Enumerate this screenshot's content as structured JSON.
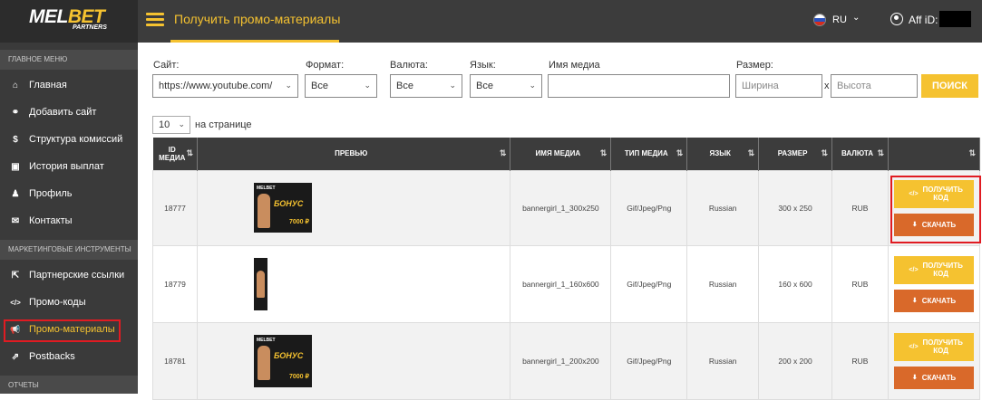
{
  "brand": {
    "logo_left": "MEL",
    "logo_right": "BET",
    "logo_sub": "PARTNERS"
  },
  "sidebar": {
    "section_main": "ГЛАВНОЕ МЕНЮ",
    "items_main": [
      {
        "label": "Главная",
        "icon": "home-icon",
        "glyph": "⌂"
      },
      {
        "label": "Добавить сайт",
        "icon": "link-icon",
        "glyph": "⚭"
      },
      {
        "label": "Структура комиссий",
        "icon": "dollar-icon",
        "glyph": "$"
      },
      {
        "label": "История выплат",
        "icon": "money-icon",
        "glyph": "▣"
      },
      {
        "label": "Профиль",
        "icon": "user-icon",
        "glyph": "♟"
      },
      {
        "label": "Контакты",
        "icon": "envelope-icon",
        "glyph": "✉"
      }
    ],
    "section_marketing": "МАРКЕТИНГОВЫЕ ИНСТРУМЕНТЫ",
    "items_marketing": [
      {
        "label": "Партнерские ссылки",
        "icon": "external-link-icon",
        "glyph": "⇱"
      },
      {
        "label": "Промо-коды",
        "icon": "code-icon",
        "glyph": "</>"
      },
      {
        "label": "Промо-материалы",
        "icon": "bullhorn-icon",
        "glyph": "📢"
      },
      {
        "label": "Postbacks",
        "icon": "share-icon",
        "glyph": "⇗"
      }
    ],
    "section_reports": "ОТЧЕТЫ"
  },
  "topbar": {
    "title": "Получить промо-материалы",
    "lang": "RU",
    "aff_label": "Aff iD:"
  },
  "filters": {
    "site_label": "Сайт:",
    "site_value": "https://www.youtube.com/",
    "format_label": "Формат:",
    "format_value": "Все",
    "currency_label": "Валюта:",
    "currency_value": "Все",
    "lang_label": "Язык:",
    "lang_value": "Все",
    "media_label": "Имя медиа",
    "media_value": "",
    "size_label": "Размер:",
    "width_ph": "Ширина",
    "x": "x",
    "height_ph": "Высота",
    "search_btn": "ПОИСК"
  },
  "pagination": {
    "per_page": "10",
    "per_page_label": "на странице"
  },
  "table": {
    "headers": [
      "ID МЕДИА",
      "ПРЕВЬЮ",
      "ИМЯ МЕДИА",
      "ТИП МЕДИА",
      "ЯЗЫК",
      "РАЗМЕР",
      "ВАЛЮТА",
      ""
    ],
    "rows": [
      {
        "id": "18777",
        "name": "bannergirl_1_300x250",
        "type": "Gif/Jpeg/Png",
        "lang": "Russian",
        "size": "300 x 250",
        "currency": "RUB"
      },
      {
        "id": "18779",
        "name": "bannergirl_1_160x600",
        "type": "Gif/Jpeg/Png",
        "lang": "Russian",
        "size": "160 x 600",
        "currency": "RUB"
      },
      {
        "id": "18781",
        "name": "bannergirl_1_200x200",
        "type": "Gif/Jpeg/Png",
        "lang": "Russian",
        "size": "200 x 200",
        "currency": "RUB"
      }
    ],
    "btn_code": "ПОЛУЧИТЬ КОД",
    "btn_download": "СКАЧАТЬ"
  },
  "banner_text": {
    "logo": "MELBET",
    "bonus": "БОНУС",
    "amount": "7000 ₽"
  },
  "colors": {
    "accent": "#f5c230",
    "download": "#d9692a",
    "highlight": "#e01b22",
    "sidebar": "#3a3a3a"
  }
}
